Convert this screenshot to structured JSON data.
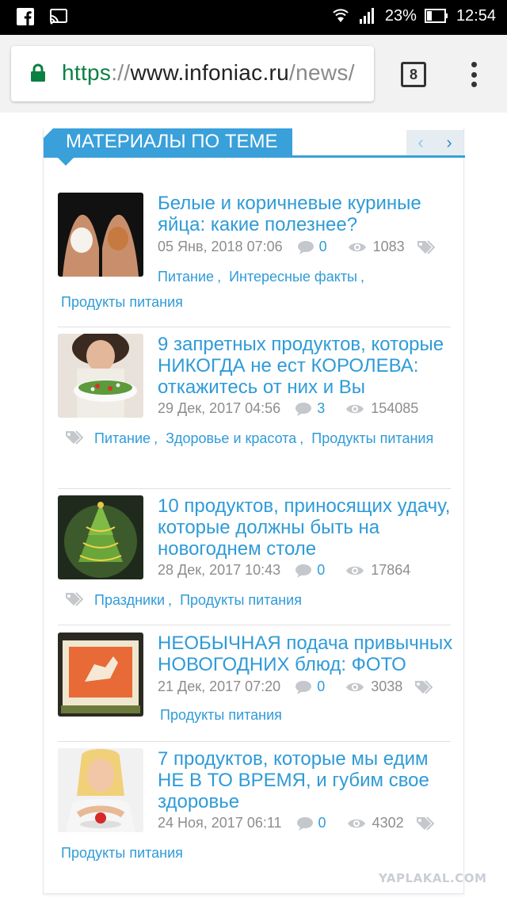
{
  "status_bar": {
    "battery": "23%",
    "time": "12:54",
    "icons": [
      "facebook-icon",
      "cast-icon",
      "wifi-icon",
      "signal-icon",
      "battery-icon"
    ]
  },
  "browser": {
    "url_scheme": "https",
    "url_separator": "://",
    "url_host": "www.infoniac.ru",
    "url_path": "/news/",
    "tab_count": "8"
  },
  "panel": {
    "title": "МАТЕРИАЛЫ ПО ТЕМЕ",
    "prev_label": "‹",
    "next_label": "›"
  },
  "articles": [
    {
      "title": "Белые и коричневые куриные яйца: какие полезнее?",
      "date": "05 Янв, 2018 07:06",
      "comments": "0",
      "views": "1083",
      "tags": [
        "Питание",
        "Интересные факты",
        "Продукты питания"
      ]
    },
    {
      "title": "9 запретных продуктов, которые НИКОГДА не ест КОРОЛЕВА: откажитесь от них и Вы",
      "date": "29 Дек, 2017 04:56",
      "comments": "3",
      "views": "154085",
      "tags": [
        "Питание",
        "Здоровье и красота",
        "Продукты питания"
      ]
    },
    {
      "title": "10 продуктов, приносящих удачу, которые должны быть на новогоднем столе",
      "date": "28 Дек, 2017 10:43",
      "comments": "0",
      "views": "17864",
      "tags": [
        "Праздники",
        "Продукты питания"
      ]
    },
    {
      "title": "НЕОБЫЧНАЯ подача привычных НОВОГОДНИХ блюд: ФОТО",
      "date": "21 Дек, 2017 07:20",
      "comments": "0",
      "views": "3038",
      "tags": [
        "Продукты питания"
      ]
    },
    {
      "title": "7 продуктов, которые мы едим НЕ В ТО ВРЕМЯ, и губим свое здоровье",
      "date": "24 Ноя, 2017 06:11",
      "comments": "0",
      "views": "4302",
      "tags": [
        "Продукты питания"
      ]
    }
  ],
  "watermark": "YAPLAKAL.COM",
  "colors": {
    "accent": "#39a0da",
    "link": "#2f9bd7",
    "meta": "#8d8d8d",
    "url_green": "#0b8043"
  }
}
